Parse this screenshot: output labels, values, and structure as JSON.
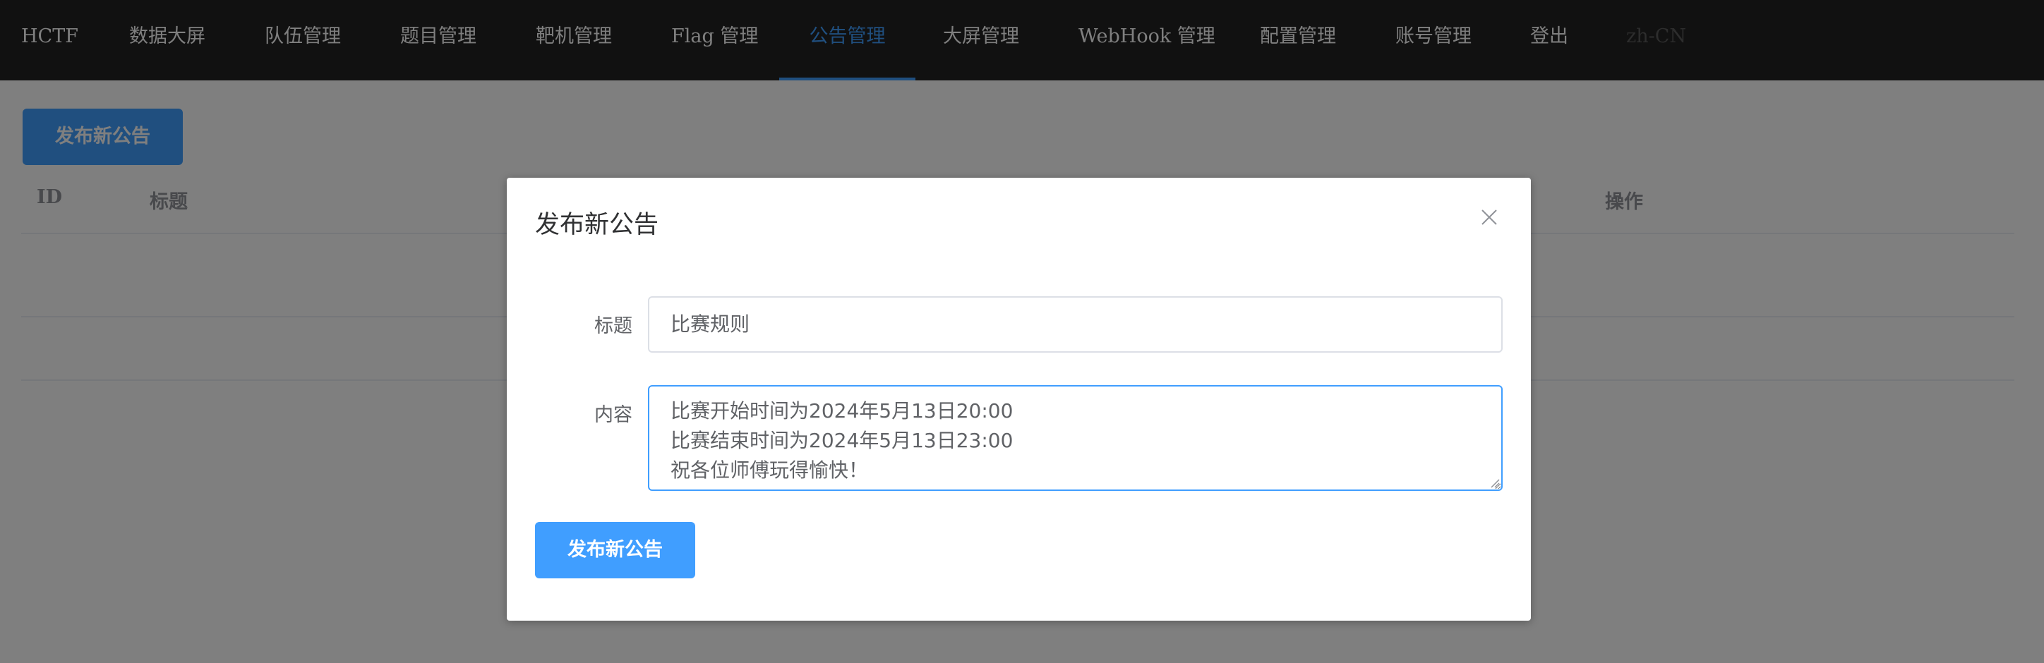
{
  "nav": {
    "brand": "HCTF",
    "items": [
      {
        "label": "数据大屏"
      },
      {
        "label": "队伍管理"
      },
      {
        "label": "题目管理"
      },
      {
        "label": "靶机管理"
      },
      {
        "label": "Flag 管理"
      },
      {
        "label": "公告管理"
      },
      {
        "label": "大屏管理"
      },
      {
        "label": "WebHook 管理"
      },
      {
        "label": "配置管理"
      },
      {
        "label": "账号管理"
      },
      {
        "label": "登出"
      },
      {
        "label": "zh-CN"
      }
    ],
    "active_item": "公告管理",
    "disabled_item": "zh-CN"
  },
  "page": {
    "publish_button_label": "发布新公告",
    "table": {
      "columns": [
        "ID",
        "标题",
        "操作"
      ]
    }
  },
  "modal": {
    "title": "发布新公告",
    "form": {
      "title_label": "标题",
      "title_value": "比赛规则",
      "content_label": "内容",
      "content_lines": [
        "比赛开始时间为2024年5月13日20:00",
        "比赛结束时间为2024年5月13日23:00",
        "祝各位师傅玩得愉快！"
      ]
    },
    "submit_label": "发布新公告"
  },
  "colors": {
    "accent": "#409eff",
    "navbar_bg": "#222222",
    "overlay": "rgba(0,0,0,0.5)"
  }
}
